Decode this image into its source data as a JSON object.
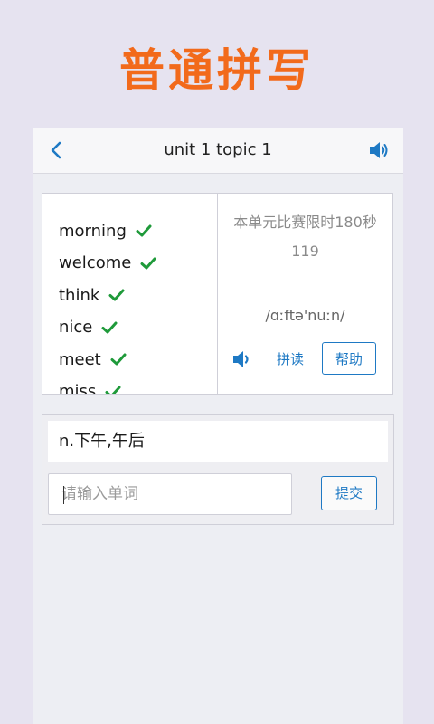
{
  "promo": {
    "title": "普通拼写"
  },
  "appbar": {
    "title": "unit 1 topic 1",
    "back_icon": "chevron-left-icon",
    "sound_icon": "speaker-icon"
  },
  "words": [
    {
      "text": "",
      "correct": false
    },
    {
      "text": "morning",
      "correct": true
    },
    {
      "text": "welcome",
      "correct": true
    },
    {
      "text": "think",
      "correct": true
    },
    {
      "text": "nice",
      "correct": true
    },
    {
      "text": "meet",
      "correct": true
    },
    {
      "text": "miss",
      "correct": true
    }
  ],
  "info": {
    "timer_text": "本单元比赛限时180秒",
    "countdown": "119",
    "phonetic": "/ɑːftə'nuːn/",
    "spell_label": "拼读",
    "help_label": "帮助"
  },
  "answer": {
    "meaning": "n.下午,午后",
    "input_value": "",
    "input_placeholder": "请输入单词",
    "submit_label": "提交"
  },
  "colors": {
    "accent": "#1e79c4",
    "check": "#1f9a3a",
    "promo": "#f26a1b"
  }
}
